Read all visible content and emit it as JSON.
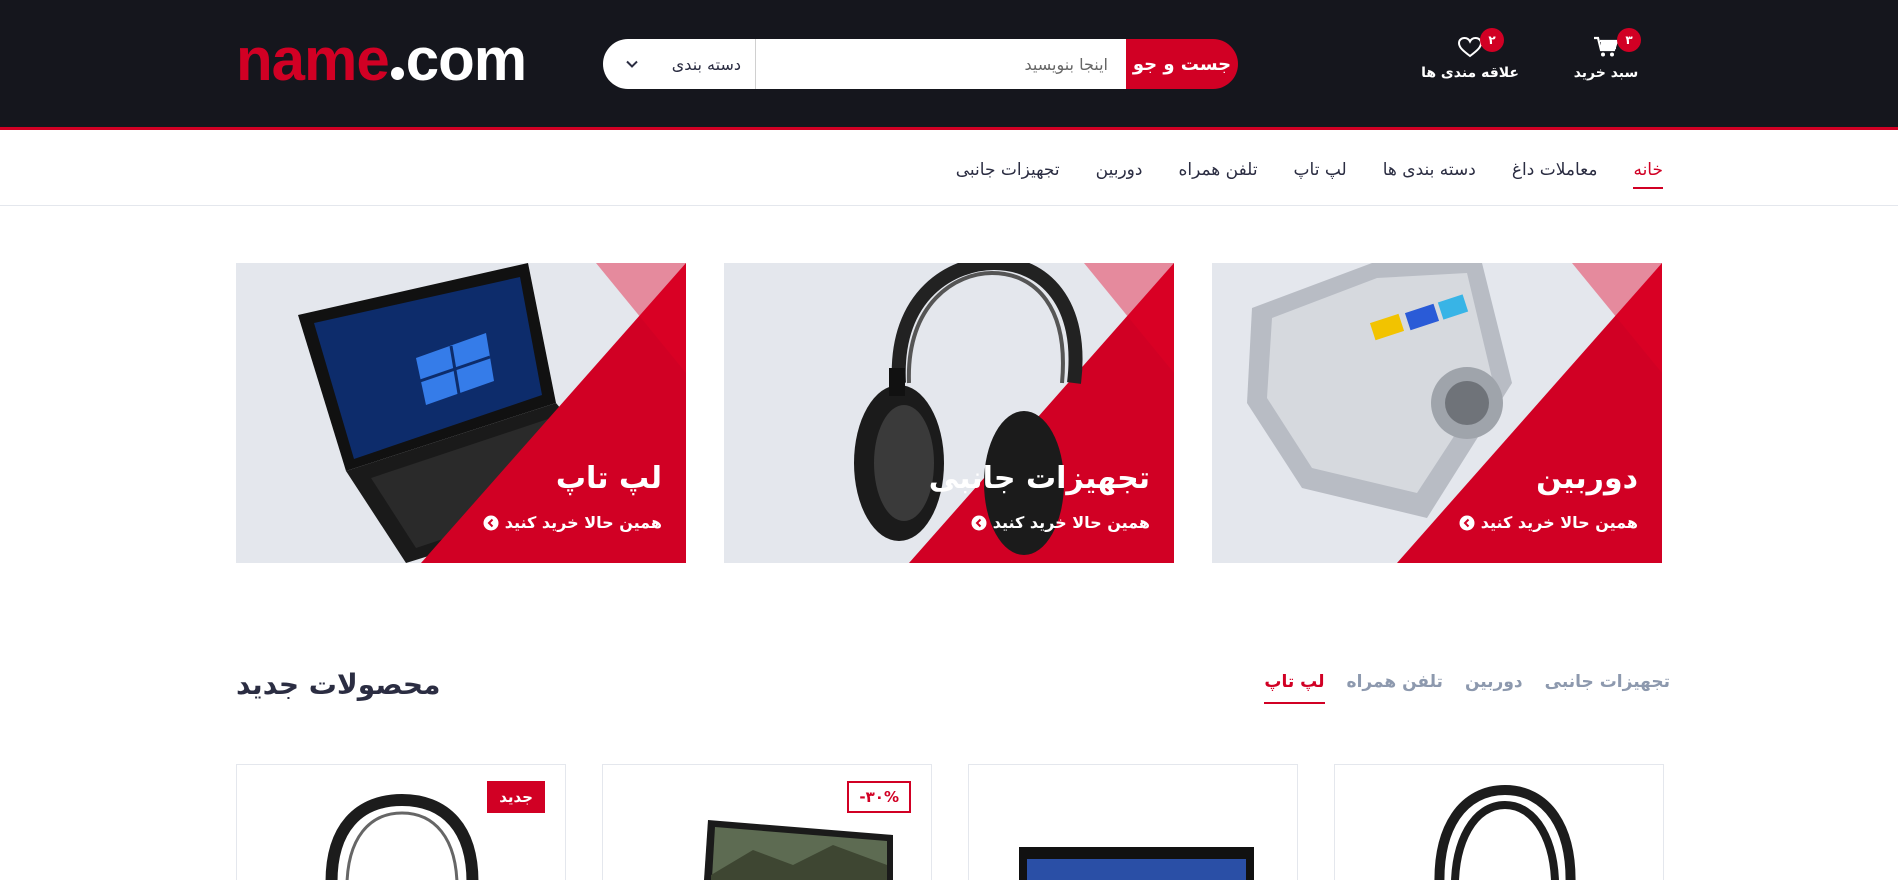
{
  "header": {
    "logo_main": "name",
    "logo_tld": "com",
    "search": {
      "button_label": "جست و جو",
      "placeholder": "اینجا بنویسید",
      "category_label": "دسته بندی"
    },
    "wishlist": {
      "label": "علاقه مندی ها",
      "count": "۲",
      "icon": "heart-icon"
    },
    "cart": {
      "label": "سبد خرید",
      "count": "۳",
      "icon": "cart-icon"
    }
  },
  "nav": {
    "items": [
      {
        "label": "خانه",
        "active": true
      },
      {
        "label": "معاملات داغ"
      },
      {
        "label": "دسته بندی ها"
      },
      {
        "label": "لپ تاپ"
      },
      {
        "label": "تلفن همراه"
      },
      {
        "label": "دوربین"
      },
      {
        "label": "تجهیزات جانبی"
      }
    ]
  },
  "banners": [
    {
      "title": "دوربین",
      "cta": "همین حالا خرید کنید",
      "image": "camera-image"
    },
    {
      "title": "تجهیزات جانبی",
      "cta": "همین حالا خرید کنید",
      "image": "headphones-image"
    },
    {
      "title": "لپ تاپ",
      "cta": "همین حالا خرید کنید",
      "image": "laptop-image"
    }
  ],
  "new_products": {
    "title": "محصولات جدید",
    "tabs": [
      {
        "label": "تجهیزات جانبی"
      },
      {
        "label": "دوربین"
      },
      {
        "label": "تلفن همراه"
      },
      {
        "label": "لپ تاپ",
        "active": true
      }
    ],
    "products": [
      {
        "image": "headphones-image",
        "badge": "جدید"
      },
      {
        "image": "laptop-image",
        "badge": "-۳۰%"
      },
      {
        "image": "tablet-image",
        "badge": ""
      },
      {
        "image": "headphones-image",
        "badge": ""
      }
    ]
  },
  "colors": {
    "brand_red": "#d10024",
    "header_bg": "#15161d",
    "banner_bg": "#e4e7ed",
    "tab_inactive": "#8d99ae"
  }
}
